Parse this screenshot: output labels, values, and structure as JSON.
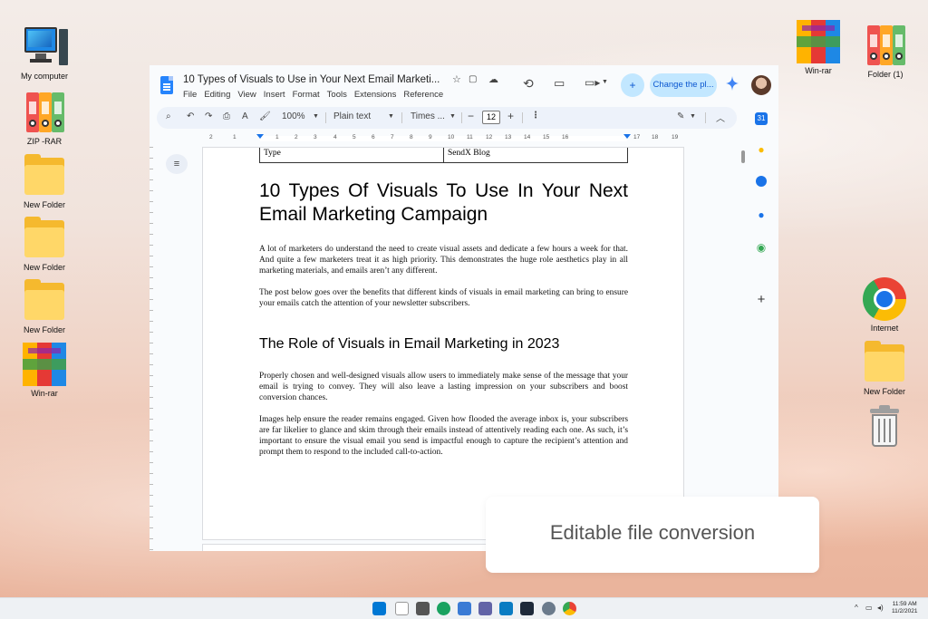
{
  "desktop": {
    "icons": [
      {
        "label": "My computer",
        "icon": "computer-icon"
      },
      {
        "label": "ZIP -RAR",
        "icon": "binders-icon"
      },
      {
        "label": "New Folder",
        "icon": "folder-icon"
      },
      {
        "label": "New Folder",
        "icon": "folder-icon"
      },
      {
        "label": "New Folder",
        "icon": "folder-icon"
      },
      {
        "label": "Win-rar",
        "icon": "winrar-icon"
      },
      {
        "label": "Win-rar",
        "icon": "winrar-icon"
      },
      {
        "label": "Folder (1)",
        "icon": "binders-icon"
      },
      {
        "label": "Internet",
        "icon": "chrome-icon"
      },
      {
        "label": "New Folder",
        "icon": "folder-icon"
      },
      {
        "label": "",
        "icon": "recycle-bin-icon"
      }
    ]
  },
  "docs": {
    "title": "10 Types of Visuals to Use in Your Next Email Marketi...",
    "menu": [
      "File",
      "Editing",
      "View",
      "Insert",
      "Format",
      "Tools",
      "Extensions",
      "Reference"
    ],
    "share_label": "Change the pl...",
    "toolbar": {
      "zoom": "100%",
      "style": "Plain text",
      "font": "Times ...",
      "font_size": "12"
    },
    "ruler_numbers": [
      "2",
      "1",
      "1",
      "2",
      "3",
      "4",
      "5",
      "6",
      "7",
      "8",
      "9",
      "10",
      "11",
      "12",
      "13",
      "14",
      "15",
      "16",
      "17",
      "18",
      "19"
    ],
    "table": {
      "col1": "Type",
      "col2": "SendX Blog"
    },
    "heading": "10 Types Of Visuals To Use In Your Next Email Marketing Campaign",
    "para1": "A lot of marketers do understand the need to create visual assets and dedicate a few hours a week for that. And quite a few marketers treat it as high priority. This demonstrates the huge role aesthetics play in all marketing materials, and emails aren’t any different.",
    "para2": "The post below goes over the benefits that different kinds of visuals in email marketing can bring to ensure your emails catch the attention of your newsletter subscribers.",
    "subheading": "The Role of Visuals in Email Marketing in 2023",
    "para3": "Properly chosen and well-designed visuals allow users to immediately make sense of the message that your email is trying to convey. They will also leave a lasting impression on your subscribers and boost conversion chances.",
    "para4": "Images help ensure the reader remains engaged. Given how flooded the average inbox is, your subscribers are far likelier to glance and skim through their emails instead of attentively reading each one. As such, it’s important to ensure the visual email you send is impactful enough to capture the recipient’s attention and prompt them to respond to the included call-to-action."
  },
  "callout": "Editable file conversion",
  "taskbar": {
    "time": "11:59 AM",
    "date": "11/2/2021"
  },
  "colors": {
    "accent": "#0b57d0",
    "share_bg": "#c2e7ff",
    "folder": "#ffd768"
  }
}
